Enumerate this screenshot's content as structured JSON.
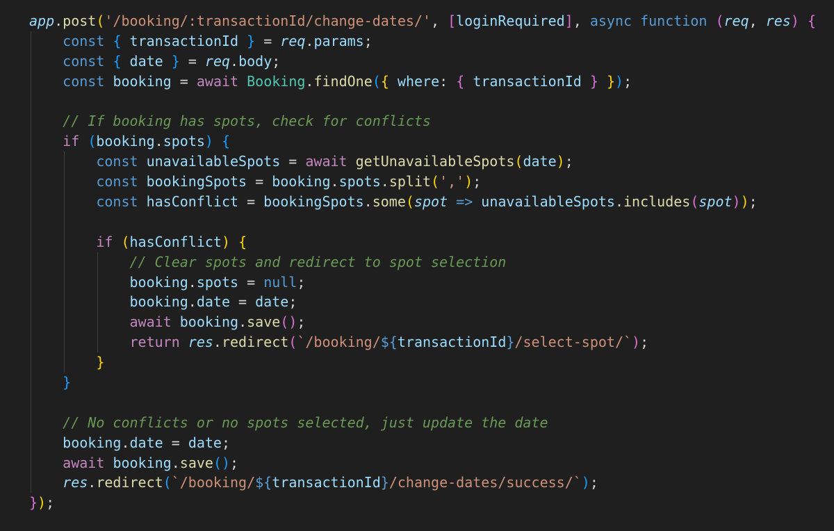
{
  "editor": {
    "theme": {
      "background": "#1f1f1f",
      "keyword": "#569cd6",
      "control": "#c586c0",
      "function": "#dcdcaa",
      "class": "#4ec9b0",
      "variable": "#9cdcfe",
      "string": "#ce9178",
      "comment": "#6a9955",
      "text": "#d4d4d4",
      "bracket1": "#ffd700",
      "bracket2": "#da70d6",
      "bracket3": "#179fff"
    },
    "lines": [
      {
        "indent": 0,
        "tokens": [
          [
            "var it",
            "app"
          ],
          [
            "plain",
            "."
          ],
          [
            "fn",
            "post"
          ],
          [
            "b1",
            "("
          ],
          [
            "str",
            "'/booking/:transactionId/change-dates/'"
          ],
          [
            "plain",
            ", "
          ],
          [
            "b2",
            "["
          ],
          [
            "var",
            "loginRequired"
          ],
          [
            "b2",
            "]"
          ],
          [
            "plain",
            ", "
          ],
          [
            "kw",
            "async function"
          ],
          [
            "plain",
            " "
          ],
          [
            "b2",
            "("
          ],
          [
            "var it",
            "req"
          ],
          [
            "plain",
            ", "
          ],
          [
            "var it",
            "res"
          ],
          [
            "b2",
            ")"
          ],
          [
            "plain",
            " "
          ],
          [
            "b2",
            "{"
          ]
        ]
      },
      {
        "indent": 1,
        "tokens": [
          [
            "kw",
            "const"
          ],
          [
            "plain",
            " "
          ],
          [
            "b3",
            "{"
          ],
          [
            "plain",
            " "
          ],
          [
            "var",
            "transactionId"
          ],
          [
            "plain",
            " "
          ],
          [
            "b3",
            "}"
          ],
          [
            "plain",
            " = "
          ],
          [
            "var it",
            "req"
          ],
          [
            "plain",
            "."
          ],
          [
            "prop",
            "params"
          ],
          [
            "plain",
            ";"
          ]
        ]
      },
      {
        "indent": 1,
        "tokens": [
          [
            "kw",
            "const"
          ],
          [
            "plain",
            " "
          ],
          [
            "b3",
            "{"
          ],
          [
            "plain",
            " "
          ],
          [
            "var",
            "date"
          ],
          [
            "plain",
            " "
          ],
          [
            "b3",
            "}"
          ],
          [
            "plain",
            " = "
          ],
          [
            "var it",
            "req"
          ],
          [
            "plain",
            "."
          ],
          [
            "prop",
            "body"
          ],
          [
            "plain",
            ";"
          ]
        ]
      },
      {
        "indent": 1,
        "tokens": [
          [
            "kw",
            "const"
          ],
          [
            "plain",
            " "
          ],
          [
            "var",
            "booking"
          ],
          [
            "plain",
            " = "
          ],
          [
            "ctl",
            "await"
          ],
          [
            "plain",
            " "
          ],
          [
            "cls",
            "Booking"
          ],
          [
            "plain",
            "."
          ],
          [
            "fn",
            "findOne"
          ],
          [
            "b3",
            "("
          ],
          [
            "b1",
            "{"
          ],
          [
            "plain",
            " "
          ],
          [
            "prop",
            "where"
          ],
          [
            "plain",
            ": "
          ],
          [
            "b2",
            "{"
          ],
          [
            "plain",
            " "
          ],
          [
            "var",
            "transactionId"
          ],
          [
            "plain",
            " "
          ],
          [
            "b2",
            "}"
          ],
          [
            "plain",
            " "
          ],
          [
            "b1",
            "}"
          ],
          [
            "b3",
            ")"
          ],
          [
            "plain",
            ";"
          ]
        ]
      },
      {
        "indent": 1,
        "tokens": []
      },
      {
        "indent": 1,
        "tokens": [
          [
            "cmt",
            "// If booking has spots, check for conflicts"
          ]
        ]
      },
      {
        "indent": 1,
        "tokens": [
          [
            "ctl",
            "if"
          ],
          [
            "plain",
            " "
          ],
          [
            "b3",
            "("
          ],
          [
            "var",
            "booking"
          ],
          [
            "plain",
            "."
          ],
          [
            "prop",
            "spots"
          ],
          [
            "b3",
            ")"
          ],
          [
            "plain",
            " "
          ],
          [
            "b3",
            "{"
          ]
        ]
      },
      {
        "indent": 2,
        "tokens": [
          [
            "kw",
            "const"
          ],
          [
            "plain",
            " "
          ],
          [
            "var",
            "unavailableSpots"
          ],
          [
            "plain",
            " = "
          ],
          [
            "ctl",
            "await"
          ],
          [
            "plain",
            " "
          ],
          [
            "fn",
            "getUnavailableSpots"
          ],
          [
            "b1",
            "("
          ],
          [
            "var",
            "date"
          ],
          [
            "b1",
            ")"
          ],
          [
            "plain",
            ";"
          ]
        ]
      },
      {
        "indent": 2,
        "tokens": [
          [
            "kw",
            "const"
          ],
          [
            "plain",
            " "
          ],
          [
            "var",
            "bookingSpots"
          ],
          [
            "plain",
            " = "
          ],
          [
            "var",
            "booking"
          ],
          [
            "plain",
            "."
          ],
          [
            "prop",
            "spots"
          ],
          [
            "plain",
            "."
          ],
          [
            "fn",
            "split"
          ],
          [
            "b1",
            "("
          ],
          [
            "str",
            "','"
          ],
          [
            "b1",
            ")"
          ],
          [
            "plain",
            ";"
          ]
        ]
      },
      {
        "indent": 2,
        "tokens": [
          [
            "kw",
            "const"
          ],
          [
            "plain",
            " "
          ],
          [
            "var",
            "hasConflict"
          ],
          [
            "plain",
            " = "
          ],
          [
            "var",
            "bookingSpots"
          ],
          [
            "plain",
            "."
          ],
          [
            "fn",
            "some"
          ],
          [
            "b1",
            "("
          ],
          [
            "var it",
            "spot"
          ],
          [
            "plain",
            " "
          ],
          [
            "kw",
            "=>"
          ],
          [
            "plain",
            " "
          ],
          [
            "var",
            "unavailableSpots"
          ],
          [
            "plain",
            "."
          ],
          [
            "fn",
            "includes"
          ],
          [
            "b2",
            "("
          ],
          [
            "var it",
            "spot"
          ],
          [
            "b2",
            ")"
          ],
          [
            "b1",
            ")"
          ],
          [
            "plain",
            ";"
          ]
        ]
      },
      {
        "indent": 2,
        "tokens": []
      },
      {
        "indent": 2,
        "tokens": [
          [
            "ctl",
            "if"
          ],
          [
            "plain",
            " "
          ],
          [
            "b1",
            "("
          ],
          [
            "var",
            "hasConflict"
          ],
          [
            "b1",
            ")"
          ],
          [
            "plain",
            " "
          ],
          [
            "b1",
            "{"
          ]
        ]
      },
      {
        "indent": 3,
        "tokens": [
          [
            "cmt",
            "// Clear spots and redirect to spot selection"
          ]
        ]
      },
      {
        "indent": 3,
        "tokens": [
          [
            "var",
            "booking"
          ],
          [
            "plain",
            "."
          ],
          [
            "prop",
            "spots"
          ],
          [
            "plain",
            " = "
          ],
          [
            "kw",
            "null"
          ],
          [
            "plain",
            ";"
          ]
        ]
      },
      {
        "indent": 3,
        "tokens": [
          [
            "var",
            "booking"
          ],
          [
            "plain",
            "."
          ],
          [
            "prop",
            "date"
          ],
          [
            "plain",
            " = "
          ],
          [
            "var",
            "date"
          ],
          [
            "plain",
            ";"
          ]
        ]
      },
      {
        "indent": 3,
        "tokens": [
          [
            "ctl",
            "await"
          ],
          [
            "plain",
            " "
          ],
          [
            "var",
            "booking"
          ],
          [
            "plain",
            "."
          ],
          [
            "fn",
            "save"
          ],
          [
            "b2",
            "("
          ],
          [
            "b2",
            ")"
          ],
          [
            "plain",
            ";"
          ]
        ]
      },
      {
        "indent": 3,
        "tokens": [
          [
            "ctl",
            "return"
          ],
          [
            "plain",
            " "
          ],
          [
            "var it",
            "res"
          ],
          [
            "plain",
            "."
          ],
          [
            "fn",
            "redirect"
          ],
          [
            "b2",
            "("
          ],
          [
            "str",
            "`/booking/"
          ],
          [
            "kw",
            "${"
          ],
          [
            "var",
            "transactionId"
          ],
          [
            "kw",
            "}"
          ],
          [
            "str",
            "/select-spot/`"
          ],
          [
            "b2",
            ")"
          ],
          [
            "plain",
            ";"
          ]
        ]
      },
      {
        "indent": 2,
        "tokens": [
          [
            "b1",
            "}"
          ]
        ]
      },
      {
        "indent": 1,
        "tokens": [
          [
            "b3",
            "}"
          ]
        ]
      },
      {
        "indent": 1,
        "tokens": []
      },
      {
        "indent": 1,
        "tokens": [
          [
            "cmt",
            "// No conflicts or no spots selected, just update the date"
          ]
        ]
      },
      {
        "indent": 1,
        "tokens": [
          [
            "var",
            "booking"
          ],
          [
            "plain",
            "."
          ],
          [
            "prop",
            "date"
          ],
          [
            "plain",
            " = "
          ],
          [
            "var",
            "date"
          ],
          [
            "plain",
            ";"
          ]
        ]
      },
      {
        "indent": 1,
        "tokens": [
          [
            "ctl",
            "await"
          ],
          [
            "plain",
            " "
          ],
          [
            "var",
            "booking"
          ],
          [
            "plain",
            "."
          ],
          [
            "fn",
            "save"
          ],
          [
            "b3",
            "("
          ],
          [
            "b3",
            ")"
          ],
          [
            "plain",
            ";"
          ]
        ]
      },
      {
        "indent": 1,
        "tokens": [
          [
            "var it",
            "res"
          ],
          [
            "plain",
            "."
          ],
          [
            "fn",
            "redirect"
          ],
          [
            "b3",
            "("
          ],
          [
            "str",
            "`/booking/"
          ],
          [
            "kw",
            "${"
          ],
          [
            "var",
            "transactionId"
          ],
          [
            "kw",
            "}"
          ],
          [
            "str",
            "/change-dates/success/`"
          ],
          [
            "b3",
            ")"
          ],
          [
            "plain",
            ";"
          ]
        ]
      },
      {
        "indent": 0,
        "tokens": [
          [
            "b2",
            "}"
          ],
          [
            "b1",
            ")"
          ],
          [
            "plain",
            ";"
          ]
        ]
      }
    ]
  }
}
